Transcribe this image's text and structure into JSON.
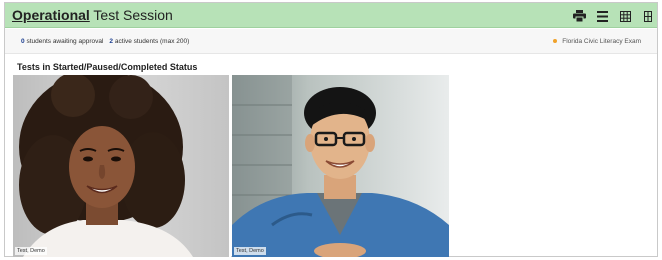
{
  "header": {
    "title_strong": "Operational",
    "title_rest": " Test Session",
    "toolbar": [
      {
        "name": "print-icon",
        "icon": "printer"
      },
      {
        "name": "list-view-icon",
        "icon": "list"
      },
      {
        "name": "grid-view-icon",
        "icon": "grid"
      },
      {
        "name": "table-view-icon",
        "icon": "table"
      }
    ]
  },
  "status": {
    "awaiting_count": "0",
    "awaiting_text": "students awaiting approval",
    "active_count": "2",
    "active_text": "active students (max 200)",
    "legend_label": "Florida Civic Literacy Exam",
    "legend_color": "#f0a22a"
  },
  "section": {
    "title": "Tests in Started/Paused/Completed Status"
  },
  "students": [
    {
      "label": "Test, Demo",
      "icon": "student-photo"
    },
    {
      "label": "Test, Demo",
      "icon": "student-photo"
    }
  ],
  "colors": {
    "header_bg": "#b7e2b7",
    "link_blue": "#1a3d8f"
  }
}
